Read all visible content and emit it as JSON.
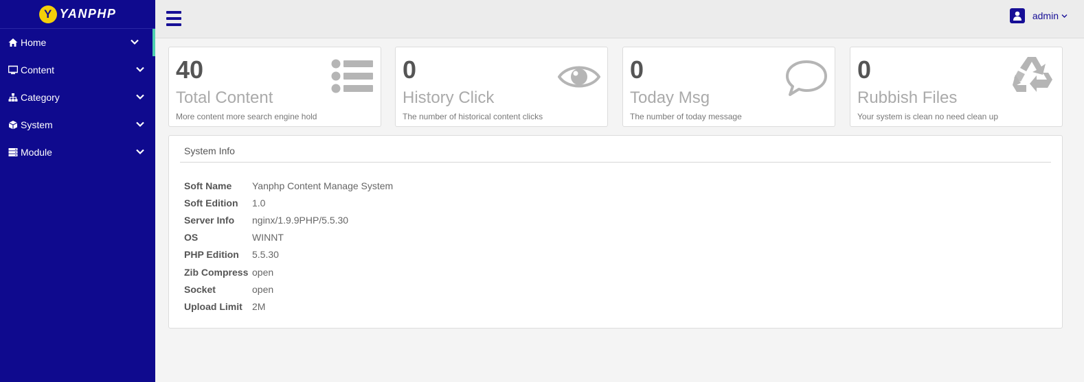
{
  "brand": {
    "logo_letter": "Y",
    "name": "YANPHP"
  },
  "sidebar": {
    "items": [
      {
        "label": "Home",
        "icon": "home-icon"
      },
      {
        "label": "Content",
        "icon": "monitor-icon"
      },
      {
        "label": "Category",
        "icon": "sitemap-icon"
      },
      {
        "label": "System",
        "icon": "cube-icon"
      },
      {
        "label": "Module",
        "icon": "server-icon"
      }
    ]
  },
  "header": {
    "user_name": "admin"
  },
  "cards": [
    {
      "number": "40",
      "label": "Total Content",
      "desc": "More content more search engine hold",
      "icon": "list-icon"
    },
    {
      "number": "0",
      "label": "History Click",
      "desc": "The number of historical content clicks",
      "icon": "eye-icon"
    },
    {
      "number": "0",
      "label": "Today Msg",
      "desc": "The number of today message",
      "icon": "comment-icon"
    },
    {
      "number": "0",
      "label": "Rubbish Files",
      "desc": "Your system is clean no need clean up",
      "icon": "recycle-icon"
    }
  ],
  "system_info": {
    "title": "System Info",
    "rows": [
      {
        "key": "Soft Name",
        "value": "Yanphp Content Manage System"
      },
      {
        "key": "Soft Edition",
        "value": "1.0"
      },
      {
        "key": "Server Info",
        "value": "nginx/1.9.9PHP/5.5.30"
      },
      {
        "key": "OS",
        "value": "WINNT"
      },
      {
        "key": "PHP Edition",
        "value": "5.5.30"
      },
      {
        "key": "Zib Compress",
        "value": "open"
      },
      {
        "key": "Socket",
        "value": "open"
      },
      {
        "key": "Upload Limit",
        "value": "2M"
      }
    ]
  },
  "colors": {
    "sidebar_bg": "#0f0a8e",
    "accent": "#160e96",
    "active_marker": "#4fd0b0",
    "logo_yellow": "#f4cf0a",
    "icon_gray": "#b5b5b5"
  }
}
